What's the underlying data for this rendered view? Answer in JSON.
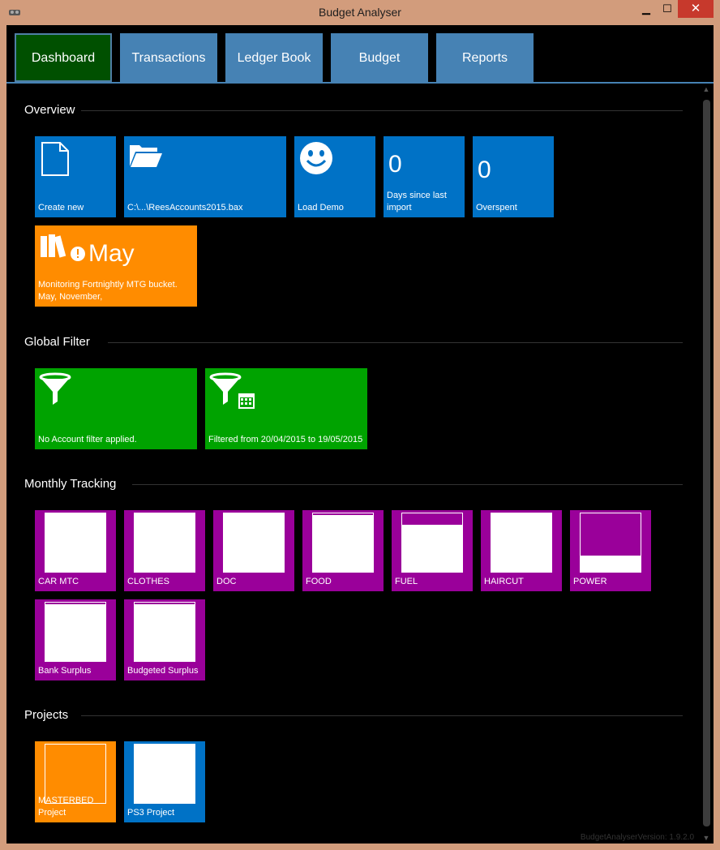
{
  "window": {
    "title": "Budget Analyser",
    "minimize_glyph": "▁",
    "maximize_glyph": "☐",
    "close_glyph": "✕"
  },
  "tabs": [
    {
      "label": "Dashboard",
      "active": true
    },
    {
      "label": "Transactions",
      "active": false
    },
    {
      "label": "Ledger Book",
      "active": false
    },
    {
      "label": "Budget",
      "active": false
    },
    {
      "label": "Reports",
      "active": false
    }
  ],
  "overview": {
    "title": "Overview",
    "create_new": "Create new",
    "file_path": "C:\\...\\ReesAccounts2015.bax",
    "load_demo": "Load Demo",
    "days_since_import_value": "0",
    "days_since_import_label": "Days since last import",
    "overspent_value": "0",
    "overspent_label": "Overspent",
    "month": "May",
    "monitoring_label": "Monitoring Fortnightly MTG bucket. May, November,"
  },
  "global_filter": {
    "title": "Global Filter",
    "account_filter": "No Account filter applied.",
    "date_filter": "Filtered from 20/04/2015 to 19/05/2015"
  },
  "monthly_tracking": {
    "title": "Monthly Tracking",
    "items": [
      {
        "label": "CAR MTC",
        "fill": 1.0
      },
      {
        "label": "CLOTHES",
        "fill": 1.0
      },
      {
        "label": "DOC",
        "fill": 1.0
      },
      {
        "label": "FOOD",
        "fill": 0.97
      },
      {
        "label": "FUEL",
        "fill": 0.8
      },
      {
        "label": "HAIRCUT",
        "fill": 1.0
      },
      {
        "label": "POWER",
        "fill": 0.28
      },
      {
        "label": "Bank Surplus",
        "fill": 0.97
      },
      {
        "label": "Budgeted Surplus",
        "fill": 0.97
      }
    ]
  },
  "projects": {
    "title": "Projects",
    "items": [
      {
        "label": "MASTERBED Project",
        "color": "orange",
        "fill": 0.0
      },
      {
        "label": "PS3 Project",
        "color": "blue",
        "fill": 1.0
      }
    ]
  },
  "version": "BudgetAnalyserVersion: 1.9.2.0",
  "colors": {
    "blue": "#0072c6",
    "orange": "#ff8c00",
    "green": "#00a300",
    "purple": "#9a009a",
    "tab": "#4682b4",
    "tab_active": "#005000"
  }
}
